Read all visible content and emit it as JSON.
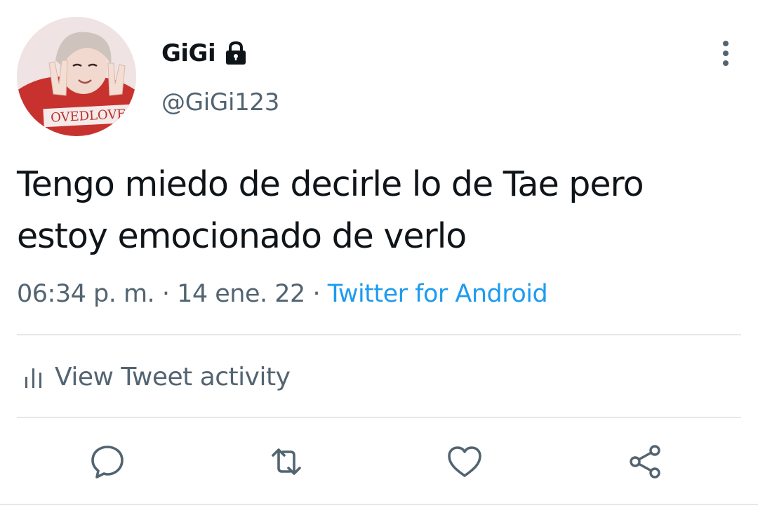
{
  "tweet": {
    "author": {
      "display_name": "GiGi",
      "handle": "@GiGi123",
      "avatar_icon": "profile-photo",
      "protected_icon": "lock-icon",
      "avatar_shirt_text": "OVEDLOVE"
    },
    "text": "Tengo miedo de decirle lo de Tae pero estoy emocionado de verlo",
    "time": "06:34 p. m.",
    "separator": "·",
    "date": "14 ene. 22",
    "source": "Twitter for Android"
  },
  "activity": {
    "label": "View Tweet activity",
    "icon": "bar-chart-icon"
  },
  "actions": [
    {
      "name": "reply",
      "icon": "speech-bubble-icon"
    },
    {
      "name": "retweet",
      "icon": "retweet-arrows-icon"
    },
    {
      "name": "like",
      "icon": "heart-icon"
    },
    {
      "name": "share",
      "icon": "share-nodes-icon"
    }
  ],
  "colors": {
    "text_primary": "#0f1419",
    "text_secondary": "#536471",
    "link": "#1d9bf0",
    "divider": "#e4e8eb",
    "icon": "#536471"
  }
}
